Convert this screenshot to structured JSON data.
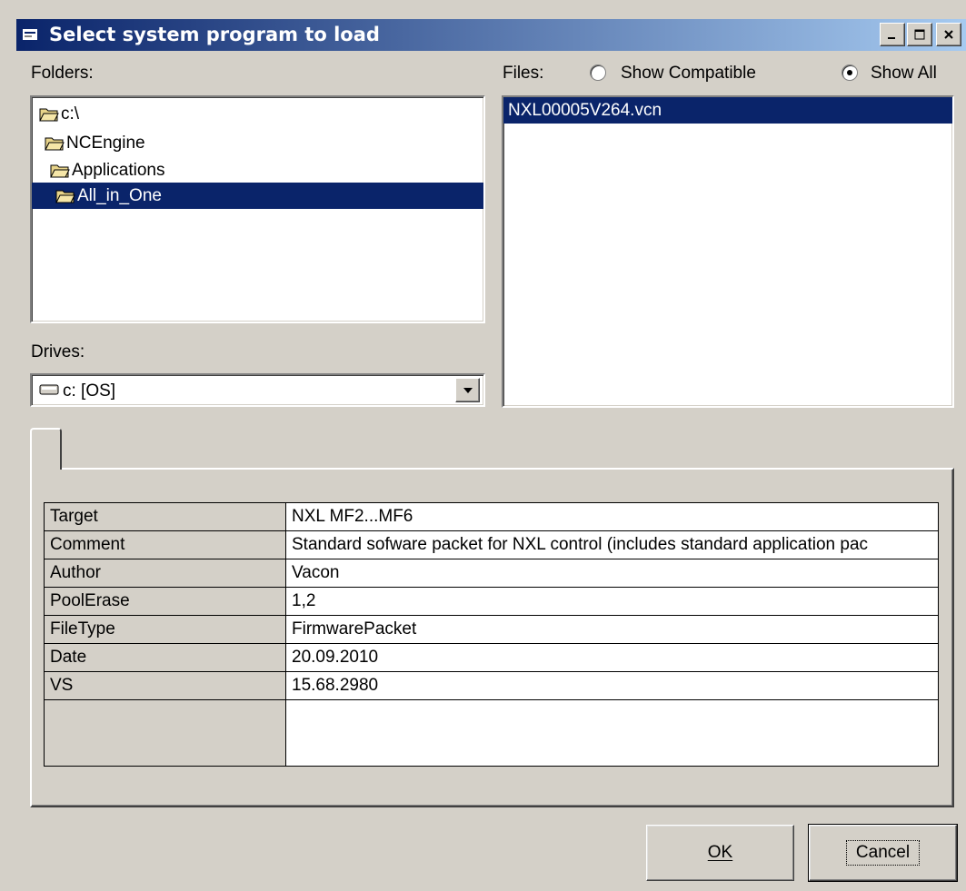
{
  "window": {
    "title": "Select system program to load"
  },
  "title_buttons": {
    "minimize": "_",
    "maximize": "□",
    "close": "×"
  },
  "folders": {
    "label": "Folders:",
    "items": [
      {
        "name": "c:\\",
        "selected": false
      },
      {
        "name": "NCEngine",
        "selected": false
      },
      {
        "name": "Applications",
        "selected": false
      },
      {
        "name": "All_in_One",
        "selected": true
      }
    ]
  },
  "drives": {
    "label": "Drives:",
    "selected": "c: [OS]"
  },
  "files": {
    "label": "Files:",
    "show_compatible_label": "Show Compatible",
    "show_all_label": "Show All",
    "show_all_checked": true,
    "items": [
      {
        "name": "NXL00005V264.vcn",
        "selected": true
      }
    ]
  },
  "properties": [
    {
      "key": "Target",
      "value": "NXL MF2...MF6"
    },
    {
      "key": "Comment",
      "value": "Standard sofware packet for NXL control (includes standard application pac"
    },
    {
      "key": "Author",
      "value": "Vacon"
    },
    {
      "key": "PoolErase",
      "value": "1,2"
    },
    {
      "key": "FileType",
      "value": "FirmwarePacket"
    },
    {
      "key": "Date",
      "value": "20.09.2010"
    },
    {
      "key": "VS",
      "value": "15.68.2980"
    }
  ],
  "buttons": {
    "ok": "OK",
    "cancel": "Cancel"
  },
  "colors": {
    "selection": "#0a246a",
    "face": "#d4d0c8"
  }
}
